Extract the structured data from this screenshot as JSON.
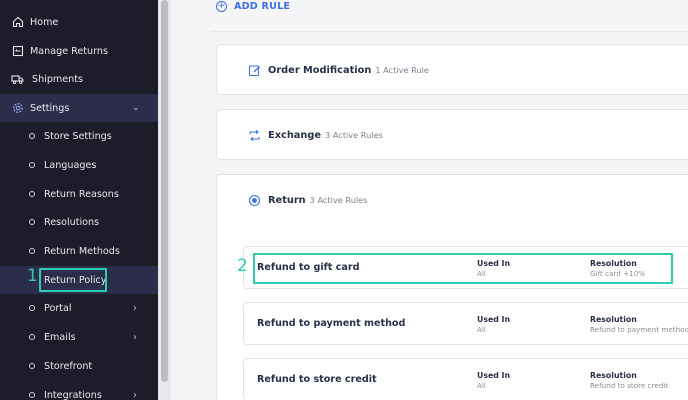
{
  "sidebar": {
    "items": [
      {
        "label": "Home",
        "icon": "home-icon"
      },
      {
        "label": "Manage Returns",
        "icon": "returns-icon"
      },
      {
        "label": "Shipments",
        "icon": "truck-icon"
      },
      {
        "label": "Settings",
        "icon": "gear-icon"
      }
    ],
    "settings_sub": [
      {
        "label": "Store Settings"
      },
      {
        "label": "Languages"
      },
      {
        "label": "Return Reasons"
      },
      {
        "label": "Resolutions"
      },
      {
        "label": "Return Methods"
      },
      {
        "label": "Return Policy"
      },
      {
        "label": "Portal"
      },
      {
        "label": "Emails"
      },
      {
        "label": "Storefront"
      },
      {
        "label": "Integrations"
      }
    ],
    "step_marker": "1"
  },
  "main": {
    "add_rule": "ADD RULE",
    "cards": [
      {
        "title": "Order Modification",
        "count": "1 Active Rule",
        "icon": "edit-icon"
      },
      {
        "title": "Exchange",
        "count": "3 Active Rules",
        "icon": "exchange-icon"
      },
      {
        "title": "Return",
        "count": "3 Active Rules",
        "icon": "return-icon"
      }
    ],
    "rules": [
      {
        "name": "Refund to gift card",
        "used_in_h": "Used In",
        "used_in": "All",
        "resolution_h": "Resolution",
        "resolution": "Gift card +10%"
      },
      {
        "name": "Refund to payment method",
        "used_in_h": "Used In",
        "used_in": "All",
        "resolution_h": "Resolution",
        "resolution": "Refund to payment method"
      },
      {
        "name": "Refund to store credit",
        "used_in_h": "Used In",
        "used_in": "All",
        "resolution_h": "Resolution",
        "resolution": "Refund to store credit"
      }
    ],
    "step_marker": "2"
  },
  "colors": {
    "sidebar_bg": "#1c1c2b",
    "accent": "#3d6fe0",
    "highlight": "#2fcab2"
  }
}
